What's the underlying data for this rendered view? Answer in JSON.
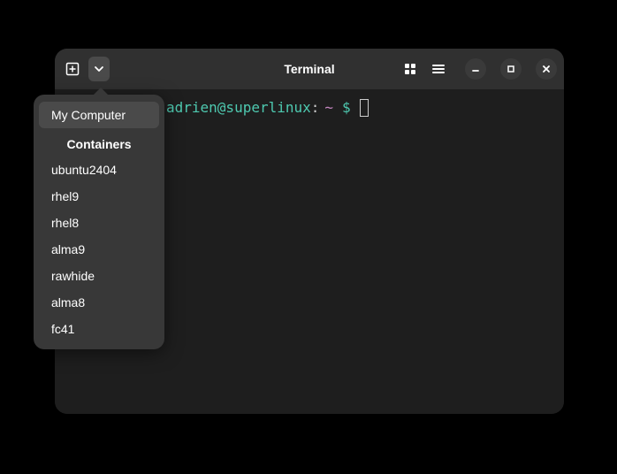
{
  "header": {
    "title": "Terminal"
  },
  "prompt": {
    "user_host": "adrien@superlinux",
    "colon": ":",
    "path": "~",
    "symbol": "$"
  },
  "popover": {
    "selected": "My Computer",
    "section_heading": "Containers",
    "containers": [
      "ubuntu2404",
      "rhel9",
      "rhel8",
      "alma9",
      "rawhide",
      "alma8",
      "fc41"
    ]
  }
}
